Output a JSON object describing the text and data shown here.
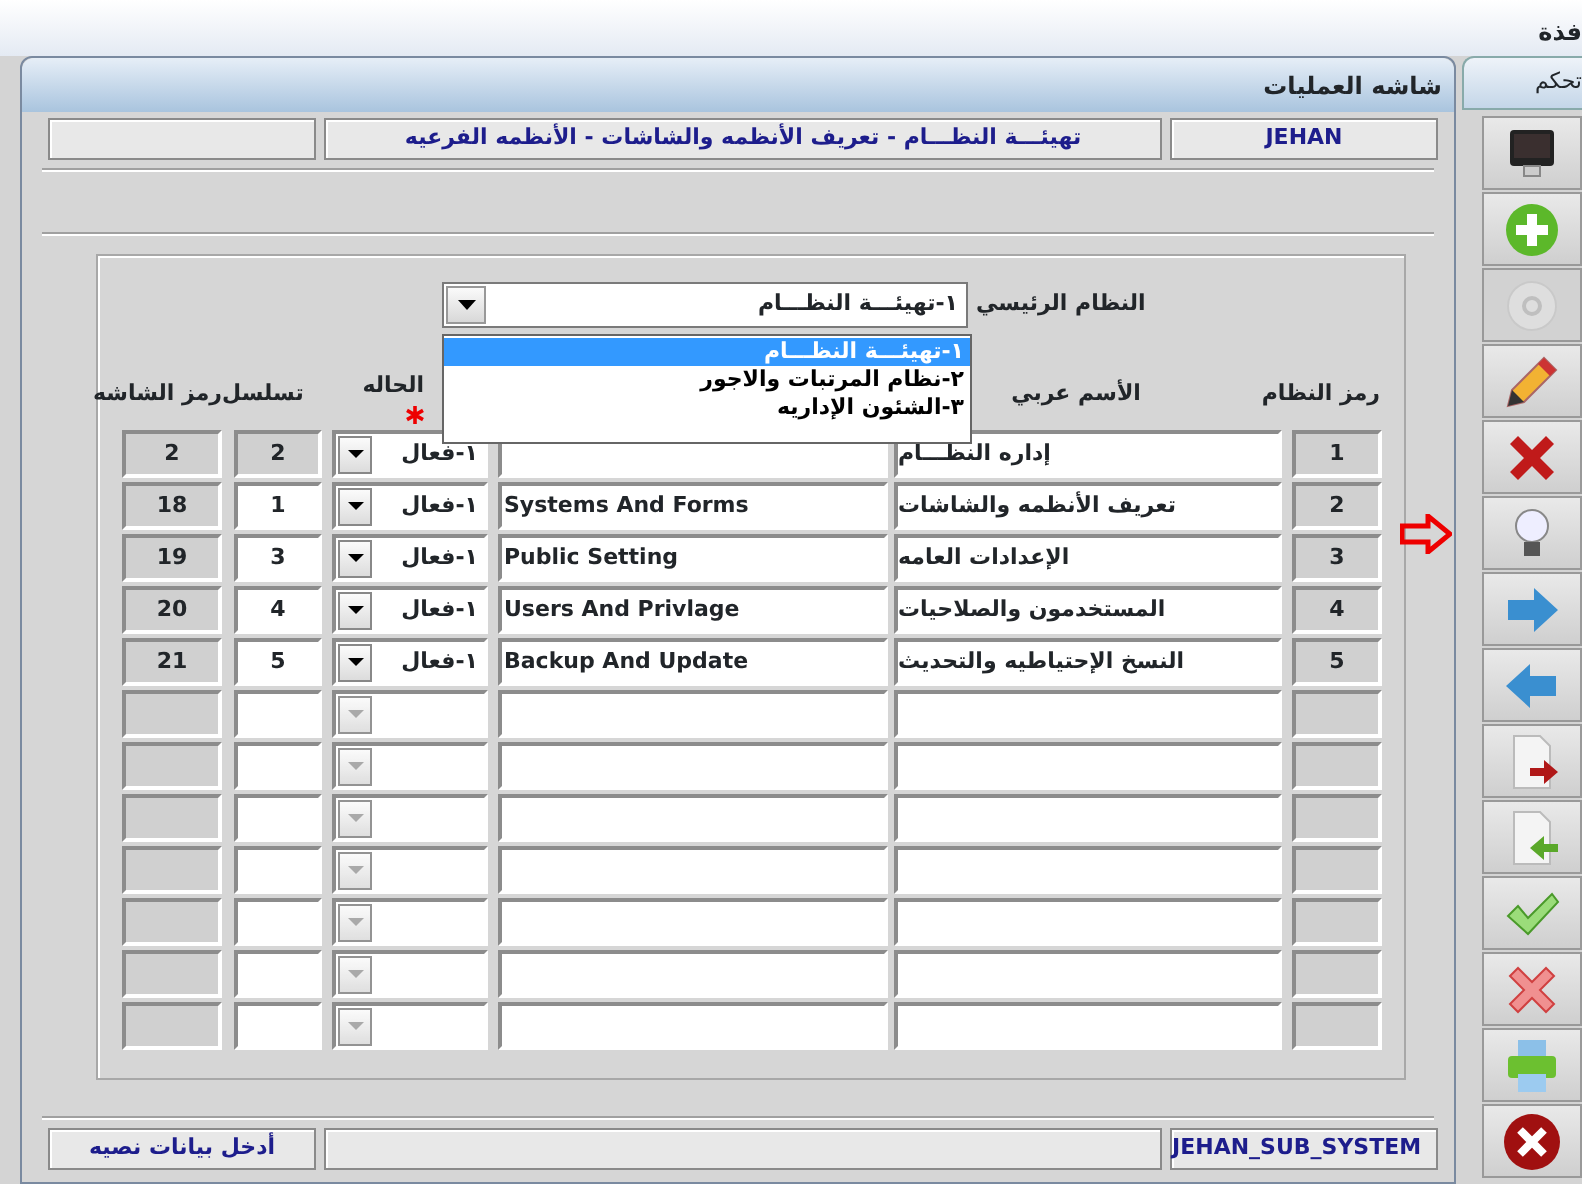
{
  "window": {
    "title": "فذة"
  },
  "panel": {
    "title": "شاشه العمليات"
  },
  "info_bar": {
    "path": "تهيئـــة النظـــام - تعريف الأنظمه والشاشات - الأنظمه الفرعيه",
    "user": "JEHAN"
  },
  "main_system": {
    "label": "النظام الرئيسي",
    "value": "١-تهيئـــة النظـــام",
    "expanded": true,
    "options": [
      {
        "label": "١-تهيئـــة النظـــام",
        "selected": true
      },
      {
        "label": "٢-نظام المرتبات والاجور",
        "selected": false
      },
      {
        "label": "٣-الشئون الإداريه",
        "selected": false
      }
    ]
  },
  "table": {
    "headers": {
      "screen_code": "رمز الشاشه",
      "sequence": "تسلسل",
      "status": "الحاله",
      "arabic_name": "الأسم عربي",
      "system_code": "رمز النظام"
    },
    "status_required": true,
    "rows": [
      {
        "kind": "filled",
        "selected": true,
        "screen_code": "2",
        "sequence": "2",
        "status": "١-فعال",
        "arabic_name": "إداره النظـــام",
        "system_code": "1"
      },
      {
        "kind": "filled",
        "selected": false,
        "screen_code": "18",
        "sequence": "1",
        "status": "١-فعال",
        "english_name": "Systems And Forms",
        "arabic_name": "تعريف الأنظمه والشاشات",
        "system_code": "2"
      },
      {
        "kind": "filled",
        "selected": false,
        "screen_code": "19",
        "sequence": "3",
        "status": "١-فعال",
        "english_name": "Public Setting",
        "arabic_name": "الإعدادات العامه",
        "system_code": "3"
      },
      {
        "kind": "filled",
        "selected": false,
        "screen_code": "20",
        "sequence": "4",
        "status": "١-فعال",
        "english_name": "Users And Privlage",
        "arabic_name": "المستخدمون والصلاحيات",
        "system_code": "4"
      },
      {
        "kind": "filled",
        "selected": false,
        "screen_code": "21",
        "sequence": "5",
        "status": "١-فعال",
        "english_name": "Backup And Update",
        "arabic_name": "النسخ الإحتياطيه والتحديث",
        "system_code": "5"
      },
      {
        "kind": "empty"
      },
      {
        "kind": "empty"
      },
      {
        "kind": "empty"
      },
      {
        "kind": "empty"
      },
      {
        "kind": "empty"
      },
      {
        "kind": "empty"
      },
      {
        "kind": "empty"
      }
    ]
  },
  "sidebar": {
    "title": "تحكم",
    "buttons": [
      {
        "kind": "monitor",
        "disabled": false,
        "pointed": false
      },
      {
        "kind": "plus",
        "disabled": false,
        "pointed": false
      },
      {
        "kind": "disc",
        "disabled": true,
        "pointed": false
      },
      {
        "kind": "pencil",
        "disabled": false,
        "pointed": false
      },
      {
        "kind": "delete",
        "disabled": false,
        "pointed": false
      },
      {
        "kind": "bulb",
        "disabled": false,
        "pointed": true
      },
      {
        "kind": "next",
        "disabled": false,
        "pointed": false
      },
      {
        "kind": "previous",
        "disabled": false,
        "pointed": false
      },
      {
        "kind": "export",
        "disabled": false,
        "pointed": false
      },
      {
        "kind": "import",
        "disabled": false,
        "pointed": false
      },
      {
        "kind": "check",
        "disabled": false,
        "pointed": false
      },
      {
        "kind": "cancel",
        "disabled": false,
        "pointed": false
      },
      {
        "kind": "printer",
        "disabled": false,
        "pointed": false
      },
      {
        "kind": "close",
        "disabled": false,
        "pointed": false
      }
    ]
  },
  "status_bar": {
    "message": "أدخل بيانات نصيه",
    "system": "JEHAN_SUB_SYSTEM"
  }
}
